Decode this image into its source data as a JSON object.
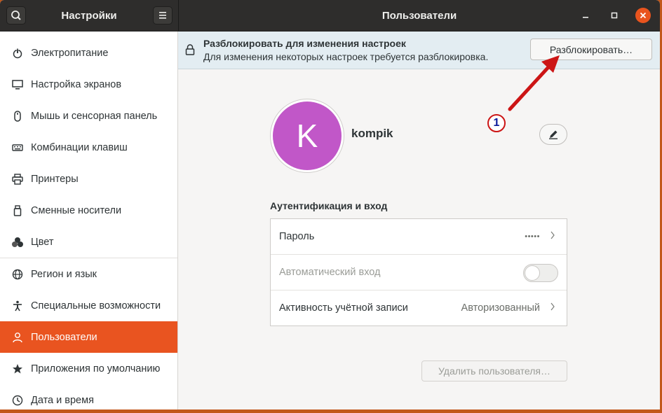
{
  "header": {
    "app_title": "Настройки",
    "page_title": "Пользователи"
  },
  "sidebar": {
    "items": [
      {
        "label": "Электропитание",
        "icon": "power-icon"
      },
      {
        "label": "Настройка экранов",
        "icon": "display-icon"
      },
      {
        "label": "Мышь и сенсорная панель",
        "icon": "mouse-icon"
      },
      {
        "label": "Комбинации клавиш",
        "icon": "keyboard-icon"
      },
      {
        "label": "Принтеры",
        "icon": "printer-icon"
      },
      {
        "label": "Сменные носители",
        "icon": "removable-media-icon"
      },
      {
        "label": "Цвет",
        "icon": "color-icon"
      },
      {
        "label": "Регион и язык",
        "icon": "globe-icon"
      },
      {
        "label": "Специальные возможности",
        "icon": "accessibility-icon"
      },
      {
        "label": "Пользователи",
        "icon": "user-icon",
        "active": true
      },
      {
        "label": "Приложения по умолчанию",
        "icon": "star-icon"
      },
      {
        "label": "Дата и время",
        "icon": "clock-icon"
      }
    ]
  },
  "infobar": {
    "title": "Разблокировать для изменения настроек",
    "subtitle": "Для изменения некоторых настроек требуется разблокировка.",
    "unlock_button": "Разблокировать…"
  },
  "user": {
    "avatar_letter": "K",
    "username": "kompik"
  },
  "auth": {
    "section_title": "Аутентификация и вход",
    "rows": [
      {
        "label": "Пароль",
        "value": "•••••"
      },
      {
        "label": "Автоматический вход",
        "value": ""
      },
      {
        "label": "Активность учётной записи",
        "value": "Авторизованный"
      }
    ],
    "autologin_enabled": false
  },
  "remove_button": "Удалить пользователя…",
  "annotation": {
    "number": "1"
  },
  "colors": {
    "accent": "#e95420",
    "avatar": "#c157c8",
    "header": "#2e2d2c",
    "infobar": "#e3edf2",
    "annotation_red": "#cc1515"
  }
}
